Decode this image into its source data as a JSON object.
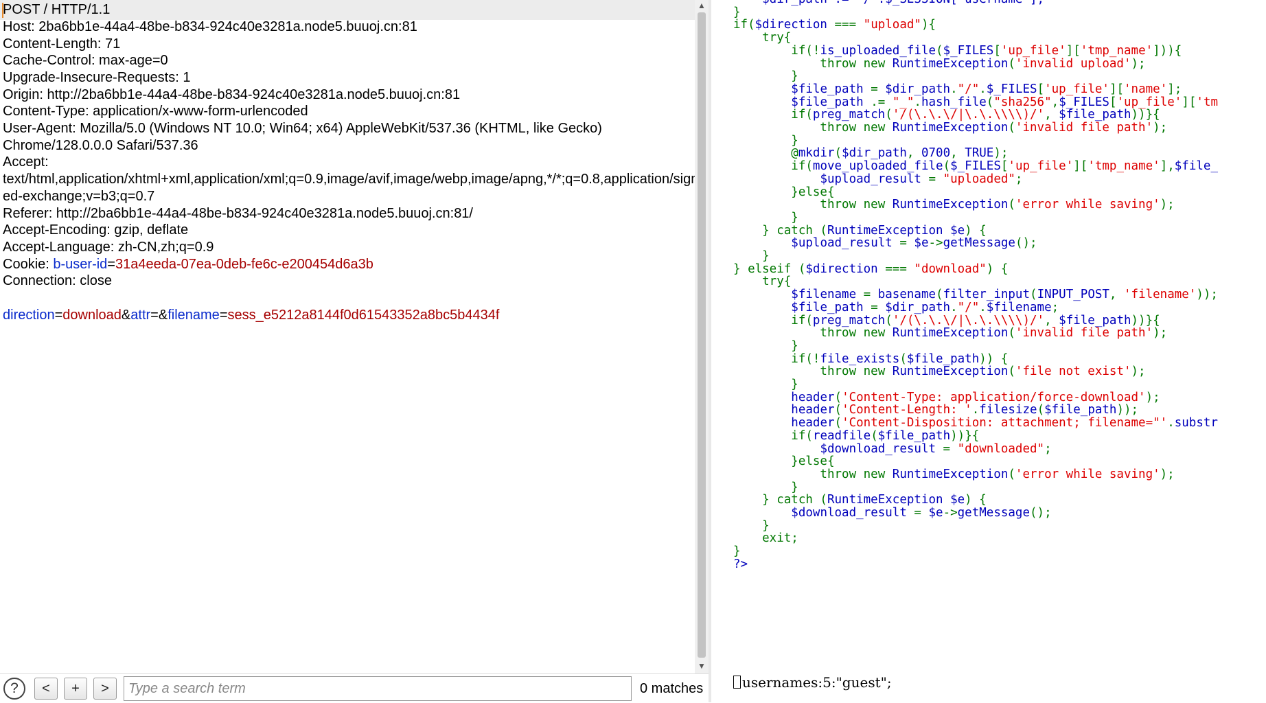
{
  "request": {
    "lines": [
      "POST / HTTP/1.1",
      "Host: 2ba6bb1e-44a4-48be-b834-924c40e3281a.node5.buuoj.cn:81",
      "Content-Length: 71",
      "Cache-Control: max-age=0",
      "Upgrade-Insecure-Requests: 1",
      "Origin: http://2ba6bb1e-44a4-48be-b834-924c40e3281a.node5.buuoj.cn:81",
      "Content-Type: application/x-www-form-urlencoded",
      "User-Agent: Mozilla/5.0 (Windows NT 10.0; Win64; x64) AppleWebKit/537.36 (KHTML, like Gecko)",
      "Chrome/128.0.0.0 Safari/537.36",
      "Accept:",
      "text/html,application/xhtml+xml,application/xml;q=0.9,image/avif,image/webp,image/apng,*/*;q=0.8,application/sign",
      "ed-exchange;v=b3;q=0.7",
      "Referer: http://2ba6bb1e-44a4-48be-b834-924c40e3281a.node5.buuoj.cn:81/",
      "Accept-Encoding: gzip, deflate",
      "Accept-Language: zh-CN,zh;q=0.9"
    ],
    "cookie_label": "Cookie: ",
    "cookie_name": "b-user-id",
    "cookie_eq": "=",
    "cookie_value": "31a4eeda-07ea-0deb-fe6c-e200454d6a3b",
    "connection_line": "Connection: close",
    "body": {
      "p1_name": "direction",
      "p1_value": "download",
      "p2_name": "attr",
      "p2_value": "",
      "p3_name": "filename",
      "p3_value": "sess_e5212a8144f0d61543352a8bc5b4434f",
      "eq": "=",
      "amp": "&"
    }
  },
  "search": {
    "help_label": "?",
    "prev_label": "<",
    "add_label": "+",
    "next_label": ">",
    "placeholder": "Type a search term",
    "value": "",
    "matches_text": "0 matches"
  },
  "scrollbar": {
    "up": "▲",
    "down": "▼"
  },
  "response": {
    "code_lines": [
      [
        [
          "    $dir_path .= \"/\".$_SESSION['username'];",
          "c-var"
        ]
      ],
      [
        [
          "}",
          "c-kw"
        ]
      ],
      [
        [
          "if(",
          "c-kw"
        ],
        [
          "$direction",
          "c-var"
        ],
        [
          " === ",
          "c-kw"
        ],
        [
          "\"upload\"",
          "c-str"
        ],
        [
          "){",
          "c-kw"
        ]
      ],
      [
        [
          "    try{",
          "c-kw"
        ]
      ],
      [
        [
          "        if(!",
          "c-kw"
        ],
        [
          "is_uploaded_file",
          "c-var"
        ],
        [
          "(",
          "c-kw"
        ],
        [
          "$_FILES",
          "c-var"
        ],
        [
          "[",
          "c-kw"
        ],
        [
          "'up_file'",
          "c-str"
        ],
        [
          "][",
          "c-kw"
        ],
        [
          "'tmp_name'",
          "c-str"
        ],
        [
          "])){",
          "c-kw"
        ]
      ],
      [
        [
          "            throw new ",
          "c-kw"
        ],
        [
          "RuntimeException",
          "c-var"
        ],
        [
          "(",
          "c-kw"
        ],
        [
          "'invalid upload'",
          "c-str"
        ],
        [
          ");",
          "c-kw"
        ]
      ],
      [
        [
          "        }",
          "c-kw"
        ]
      ],
      [
        [
          "        ",
          "c-kw"
        ],
        [
          "$file_path",
          "c-var"
        ],
        [
          " = ",
          "c-kw"
        ],
        [
          "$dir_path",
          "c-var"
        ],
        [
          ".",
          "c-kw"
        ],
        [
          "\"/\"",
          "c-str"
        ],
        [
          ".",
          "c-kw"
        ],
        [
          "$_FILES",
          "c-var"
        ],
        [
          "[",
          "c-kw"
        ],
        [
          "'up_file'",
          "c-str"
        ],
        [
          "][",
          "c-kw"
        ],
        [
          "'name'",
          "c-str"
        ],
        [
          "];",
          "c-kw"
        ]
      ],
      [
        [
          "        ",
          "c-kw"
        ],
        [
          "$file_path",
          "c-var"
        ],
        [
          " .= ",
          "c-kw"
        ],
        [
          "\"_\"",
          "c-str"
        ],
        [
          ".",
          "c-kw"
        ],
        [
          "hash_file",
          "c-var"
        ],
        [
          "(",
          "c-kw"
        ],
        [
          "\"sha256\"",
          "c-str"
        ],
        [
          ",",
          "c-kw"
        ],
        [
          "$_FILES",
          "c-var"
        ],
        [
          "[",
          "c-kw"
        ],
        [
          "'up_file'",
          "c-str"
        ],
        [
          "][",
          "c-kw"
        ],
        [
          "'tm",
          "c-str"
        ]
      ],
      [
        [
          "        if(",
          "c-kw"
        ],
        [
          "preg_match",
          "c-var"
        ],
        [
          "(",
          "c-kw"
        ],
        [
          "'/(\\.\\.\\/|\\.\\.\\\\\\\\)/'",
          "c-str"
        ],
        [
          ", ",
          "c-kw"
        ],
        [
          "$file_path",
          "c-var"
        ],
        [
          "))}{",
          "c-kw"
        ]
      ],
      [
        [
          "            throw new ",
          "c-kw"
        ],
        [
          "RuntimeException",
          "c-var"
        ],
        [
          "(",
          "c-kw"
        ],
        [
          "'invalid file path'",
          "c-str"
        ],
        [
          ");",
          "c-kw"
        ]
      ],
      [
        [
          "        }",
          "c-kw"
        ]
      ],
      [
        [
          "        @",
          "c-kw"
        ],
        [
          "mkdir",
          "c-var"
        ],
        [
          "(",
          "c-kw"
        ],
        [
          "$dir_path",
          "c-var"
        ],
        [
          ", ",
          "c-kw"
        ],
        [
          "0700",
          "c-var"
        ],
        [
          ", ",
          "c-kw"
        ],
        [
          "TRUE",
          "c-var"
        ],
        [
          ");",
          "c-kw"
        ]
      ],
      [
        [
          "        if(",
          "c-kw"
        ],
        [
          "move_uploaded_file",
          "c-var"
        ],
        [
          "(",
          "c-kw"
        ],
        [
          "$_FILES",
          "c-var"
        ],
        [
          "[",
          "c-kw"
        ],
        [
          "'up_file'",
          "c-str"
        ],
        [
          "][",
          "c-kw"
        ],
        [
          "'tmp_name'",
          "c-str"
        ],
        [
          "],",
          "c-kw"
        ],
        [
          "$file_",
          "c-var"
        ]
      ],
      [
        [
          "            ",
          "c-kw"
        ],
        [
          "$upload_result",
          "c-var"
        ],
        [
          " = ",
          "c-kw"
        ],
        [
          "\"uploaded\"",
          "c-str"
        ],
        [
          ";",
          "c-kw"
        ]
      ],
      [
        [
          "        }else{",
          "c-kw"
        ]
      ],
      [
        [
          "            throw new ",
          "c-kw"
        ],
        [
          "RuntimeException",
          "c-var"
        ],
        [
          "(",
          "c-kw"
        ],
        [
          "'error while saving'",
          "c-str"
        ],
        [
          ");",
          "c-kw"
        ]
      ],
      [
        [
          "        }",
          "c-kw"
        ]
      ],
      [
        [
          "    } catch (",
          "c-kw"
        ],
        [
          "RuntimeException ",
          "c-var"
        ],
        [
          "$e",
          "c-var"
        ],
        [
          ") {",
          "c-kw"
        ]
      ],
      [
        [
          "        ",
          "c-kw"
        ],
        [
          "$upload_result",
          "c-var"
        ],
        [
          " = ",
          "c-kw"
        ],
        [
          "$e",
          "c-var"
        ],
        [
          "->",
          "c-kw"
        ],
        [
          "getMessage",
          "c-var"
        ],
        [
          "();",
          "c-kw"
        ]
      ],
      [
        [
          "    }",
          "c-kw"
        ]
      ],
      [
        [
          "} elseif (",
          "c-kw"
        ],
        [
          "$direction",
          "c-var"
        ],
        [
          " === ",
          "c-kw"
        ],
        [
          "\"download\"",
          "c-str"
        ],
        [
          ") {",
          "c-kw"
        ]
      ],
      [
        [
          "    try{",
          "c-kw"
        ]
      ],
      [
        [
          "        ",
          "c-kw"
        ],
        [
          "$filename",
          "c-var"
        ],
        [
          " = ",
          "c-kw"
        ],
        [
          "basename",
          "c-var"
        ],
        [
          "(",
          "c-kw"
        ],
        [
          "filter_input",
          "c-var"
        ],
        [
          "(",
          "c-kw"
        ],
        [
          "INPUT_POST",
          "c-var"
        ],
        [
          ", ",
          "c-kw"
        ],
        [
          "'filename'",
          "c-str"
        ],
        [
          "));",
          "c-kw"
        ]
      ],
      [
        [
          "        ",
          "c-kw"
        ],
        [
          "$file_path",
          "c-var"
        ],
        [
          " = ",
          "c-kw"
        ],
        [
          "$dir_path",
          "c-var"
        ],
        [
          ".",
          "c-kw"
        ],
        [
          "\"/\"",
          "c-str"
        ],
        [
          ".",
          "c-kw"
        ],
        [
          "$filename",
          "c-var"
        ],
        [
          ";",
          "c-kw"
        ]
      ],
      [
        [
          "        if(",
          "c-kw"
        ],
        [
          "preg_match",
          "c-var"
        ],
        [
          "(",
          "c-kw"
        ],
        [
          "'/(\\.\\.\\/|\\.\\.\\\\\\\\)/'",
          "c-str"
        ],
        [
          ", ",
          "c-kw"
        ],
        [
          "$file_path",
          "c-var"
        ],
        [
          "))}{",
          "c-kw"
        ]
      ],
      [
        [
          "            throw new ",
          "c-kw"
        ],
        [
          "RuntimeException",
          "c-var"
        ],
        [
          "(",
          "c-kw"
        ],
        [
          "'invalid file path'",
          "c-str"
        ],
        [
          ");",
          "c-kw"
        ]
      ],
      [
        [
          "        }",
          "c-kw"
        ]
      ],
      [
        [
          "        if(!",
          "c-kw"
        ],
        [
          "file_exists",
          "c-var"
        ],
        [
          "(",
          "c-kw"
        ],
        [
          "$file_path",
          "c-var"
        ],
        [
          ")) {",
          "c-kw"
        ]
      ],
      [
        [
          "            throw new ",
          "c-kw"
        ],
        [
          "RuntimeException",
          "c-var"
        ],
        [
          "(",
          "c-kw"
        ],
        [
          "'file not exist'",
          "c-str"
        ],
        [
          ");",
          "c-kw"
        ]
      ],
      [
        [
          "        }",
          "c-kw"
        ]
      ],
      [
        [
          "        ",
          "c-kw"
        ],
        [
          "header",
          "c-var"
        ],
        [
          "(",
          "c-kw"
        ],
        [
          "'Content-Type: application/force-download'",
          "c-str"
        ],
        [
          ");",
          "c-kw"
        ]
      ],
      [
        [
          "        ",
          "c-kw"
        ],
        [
          "header",
          "c-var"
        ],
        [
          "(",
          "c-kw"
        ],
        [
          "'Content-Length: '",
          "c-str"
        ],
        [
          ".",
          "c-kw"
        ],
        [
          "filesize",
          "c-var"
        ],
        [
          "(",
          "c-kw"
        ],
        [
          "$file_path",
          "c-var"
        ],
        [
          "));",
          "c-kw"
        ]
      ],
      [
        [
          "        ",
          "c-kw"
        ],
        [
          "header",
          "c-var"
        ],
        [
          "(",
          "c-kw"
        ],
        [
          "'Content-Disposition: attachment; filename=\"'",
          "c-str"
        ],
        [
          ".",
          "c-kw"
        ],
        [
          "substr",
          "c-var"
        ]
      ],
      [
        [
          "        if(",
          "c-kw"
        ],
        [
          "readfile",
          "c-var"
        ],
        [
          "(",
          "c-kw"
        ],
        [
          "$file_path",
          "c-var"
        ],
        [
          "))}{",
          "c-kw"
        ]
      ],
      [
        [
          "            ",
          "c-kw"
        ],
        [
          "$download_result",
          "c-var"
        ],
        [
          " = ",
          "c-kw"
        ],
        [
          "\"downloaded\"",
          "c-str"
        ],
        [
          ";",
          "c-kw"
        ]
      ],
      [
        [
          "        }else{",
          "c-kw"
        ]
      ],
      [
        [
          "            throw new ",
          "c-kw"
        ],
        [
          "RuntimeException",
          "c-var"
        ],
        [
          "(",
          "c-kw"
        ],
        [
          "'error while saving'",
          "c-str"
        ],
        [
          ");",
          "c-kw"
        ]
      ],
      [
        [
          "        }",
          "c-kw"
        ]
      ],
      [
        [
          "    } catch (",
          "c-kw"
        ],
        [
          "RuntimeException ",
          "c-var"
        ],
        [
          "$e",
          "c-var"
        ],
        [
          ") {",
          "c-kw"
        ]
      ],
      [
        [
          "        ",
          "c-kw"
        ],
        [
          "$download_result",
          "c-var"
        ],
        [
          " = ",
          "c-kw"
        ],
        [
          "$e",
          "c-var"
        ],
        [
          "->",
          "c-kw"
        ],
        [
          "getMessage",
          "c-var"
        ],
        [
          "();",
          "c-kw"
        ]
      ],
      [
        [
          "    }",
          "c-kw"
        ]
      ],
      [
        [
          "    exit;",
          "c-kw"
        ]
      ],
      [
        [
          "}",
          "c-kw"
        ]
      ],
      [
        [
          "?>",
          "c-var"
        ]
      ]
    ],
    "tail_text": "usernames:5:\"guest\";"
  }
}
